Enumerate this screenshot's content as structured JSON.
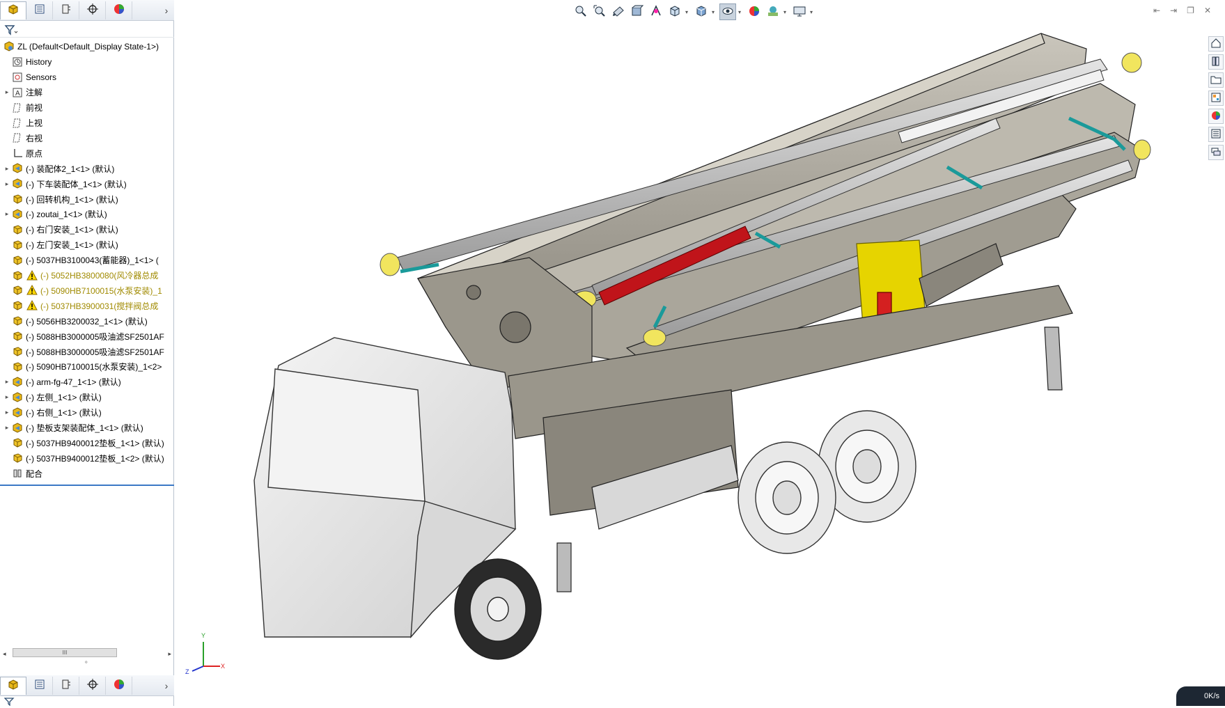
{
  "feature_manager": {
    "tabs": [
      {
        "name": "feature-manager-tab",
        "icon": "feature-manager-icon",
        "active": true
      },
      {
        "name": "property-manager-tab",
        "icon": "property-manager-icon",
        "active": false
      },
      {
        "name": "configuration-manager-tab",
        "icon": "configuration-manager-icon",
        "active": false
      },
      {
        "name": "dimxpert-tab",
        "icon": "dimxpert-icon",
        "active": false
      },
      {
        "name": "display-manager-tab",
        "icon": "display-manager-icon",
        "active": false
      }
    ],
    "more_symbol": "›",
    "tree": [
      {
        "label": "ZL  (Default<Default_Display State-1>)",
        "type": "root",
        "expandable": false,
        "indent": 0
      },
      {
        "label": "History",
        "type": "history",
        "expandable": false,
        "indent": 1
      },
      {
        "label": "Sensors",
        "type": "sensors",
        "expandable": false,
        "indent": 1
      },
      {
        "label": "注解",
        "type": "annotations",
        "expandable": true,
        "indent": 1
      },
      {
        "label": "前视",
        "type": "plane",
        "expandable": false,
        "indent": 1
      },
      {
        "label": "上视",
        "type": "plane",
        "expandable": false,
        "indent": 1
      },
      {
        "label": "右视",
        "type": "plane",
        "expandable": false,
        "indent": 1
      },
      {
        "label": "原点",
        "type": "origin",
        "expandable": false,
        "indent": 1
      },
      {
        "label": "(-) 装配体2_1<1> (默认)",
        "type": "subassembly",
        "expandable": true,
        "indent": 1
      },
      {
        "label": "(-) 下车装配体_1<1> (默认)",
        "type": "subassembly",
        "expandable": true,
        "indent": 1
      },
      {
        "label": "(-) 回转机构_1<1> (默认)",
        "type": "part",
        "expandable": false,
        "indent": 1
      },
      {
        "label": "(-) zoutai_1<1> (默认)",
        "type": "subassembly",
        "expandable": true,
        "indent": 1
      },
      {
        "label": "(-) 右门安装_1<1> (默认)",
        "type": "part",
        "expandable": false,
        "indent": 1
      },
      {
        "label": "(-) 左门安装_1<1> (默认)",
        "type": "part",
        "expandable": false,
        "indent": 1
      },
      {
        "label": "(-) 5037HB3100043(蓄能器)_1<1> (",
        "type": "part",
        "expandable": false,
        "indent": 1
      },
      {
        "label": "(-) 5052HB3800080(风冷器总成",
        "type": "part-warning",
        "expandable": false,
        "indent": 1
      },
      {
        "label": "(-) 5090HB7100015(水泵安装)_1",
        "type": "part-warning",
        "expandable": false,
        "indent": 1
      },
      {
        "label": "(-) 5037HB3900031(搅拌阀总成",
        "type": "part-warning",
        "expandable": false,
        "indent": 1
      },
      {
        "label": "(-) 5056HB3200032_1<1> (默认)",
        "type": "part",
        "expandable": false,
        "indent": 1
      },
      {
        "label": "(-) 5088HB3000005吸油滤SF2501AF",
        "type": "part",
        "expandable": false,
        "indent": 1
      },
      {
        "label": "(-) 5088HB3000005吸油滤SF2501AF",
        "type": "part",
        "expandable": false,
        "indent": 1
      },
      {
        "label": "(-) 5090HB7100015(水泵安装)_1<2>",
        "type": "part",
        "expandable": false,
        "indent": 1
      },
      {
        "label": "(-) arm-fg-47_1<1> (默认)",
        "type": "subassembly",
        "expandable": true,
        "indent": 1
      },
      {
        "label": "(-) 左侧_1<1> (默认)",
        "type": "subassembly",
        "expandable": true,
        "indent": 1
      },
      {
        "label": "(-) 右侧_1<1> (默认)",
        "type": "subassembly",
        "expandable": true,
        "indent": 1
      },
      {
        "label": "(-) 垫板支架装配体_1<1> (默认)",
        "type": "subassembly",
        "expandable": true,
        "indent": 1
      },
      {
        "label": "(-) 5037HB9400012垫板_1<1> (默认)",
        "type": "part",
        "expandable": false,
        "indent": 1
      },
      {
        "label": "(-) 5037HB9400012垫板_1<2> (默认)",
        "type": "part",
        "expandable": false,
        "indent": 1
      },
      {
        "label": "配合",
        "type": "mates",
        "expandable": false,
        "indent": 1
      }
    ],
    "scroll_grip": "III"
  },
  "heads_up_toolbar": [
    {
      "name": "zoom-to-fit-button",
      "icon": "zoom-to-fit-icon"
    },
    {
      "name": "zoom-to-area-button",
      "icon": "zoom-to-area-icon"
    },
    {
      "name": "previous-view-button",
      "icon": "previous-view-icon"
    },
    {
      "name": "section-view-button",
      "icon": "section-view-icon"
    },
    {
      "name": "dynamic-annotation-button",
      "icon": "dynamic-annotation-icon"
    },
    {
      "name": "view-orientation-button",
      "icon": "view-orientation-icon",
      "dropdown": true
    },
    {
      "name": "display-style-button",
      "icon": "display-style-icon",
      "dropdown": true
    },
    {
      "name": "hide-show-items-button",
      "icon": "hide-show-icon",
      "dropdown": true,
      "selected": true
    },
    {
      "name": "edit-appearance-button",
      "icon": "edit-appearance-icon"
    },
    {
      "name": "apply-scene-button",
      "icon": "apply-scene-icon",
      "dropdown": true
    },
    {
      "name": "view-settings-button",
      "icon": "view-settings-icon",
      "dropdown": true
    }
  ],
  "task_pane": [
    {
      "name": "solidworks-resources-button",
      "icon": "home-icon"
    },
    {
      "name": "design-library-button",
      "icon": "design-library-icon"
    },
    {
      "name": "file-explorer-button",
      "icon": "folder-icon"
    },
    {
      "name": "view-palette-button",
      "icon": "view-palette-icon"
    },
    {
      "name": "appearances-button",
      "icon": "appearances-icon"
    },
    {
      "name": "custom-properties-button",
      "icon": "custom-properties-icon"
    },
    {
      "name": "forum-button",
      "icon": "forum-icon"
    }
  ],
  "triad": {
    "x": "X",
    "y": "Y",
    "z": "Z"
  },
  "status": {
    "speed": "0K/s"
  },
  "colors": {
    "accent": "#3b78c6",
    "boom_gray": "#a8a49a",
    "pipe": "#c8c8c8",
    "highlight_red": "#c0141a",
    "yellow": "#e6d400",
    "cyan": "#27c2c2"
  }
}
